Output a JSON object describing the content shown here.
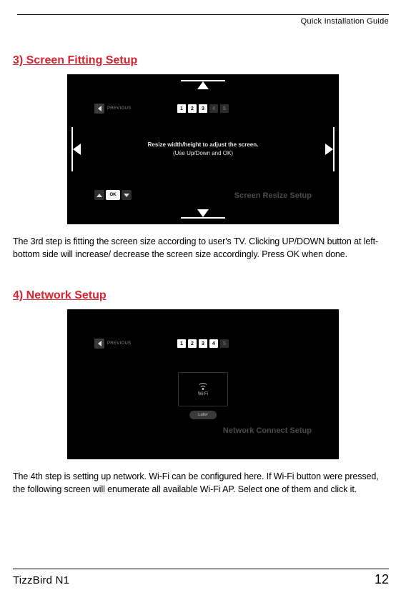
{
  "header": {
    "guide_label": "Quick Installation Guide"
  },
  "section3": {
    "title": "3) Screen Fitting Setup",
    "screen": {
      "previous": "PREVIOUS",
      "steps": [
        "1",
        "2",
        "3",
        "4",
        "5"
      ],
      "active_steps": [
        1,
        2,
        3
      ],
      "resize_line1": "Resize width/height to adjust the screen.",
      "resize_line2": "(Use Up/Down and OK)",
      "ok_label": "OK",
      "corner": "Screen Resize Setup"
    },
    "body": "The 3rd step is fitting the screen size according to user's TV. Clicking UP/DOWN button at left-bottom side will increase/ decrease the screen size accordingly. Press OK when done."
  },
  "section4": {
    "title": "4) Network Setup",
    "screen": {
      "previous": "PREVIOUS",
      "steps": [
        "1",
        "2",
        "3",
        "4",
        "5"
      ],
      "active_steps": [
        1,
        2,
        3,
        4
      ],
      "wifi_label": "Wi-Fi",
      "later_label": "Later",
      "corner": "Network Connect Setup"
    },
    "body": "The 4th step is setting up network. Wi-Fi can be configured here. If Wi-Fi button were pressed, the following screen will enumerate all available Wi-Fi AP. Select one of them and click it."
  },
  "footer": {
    "brand": "TizzBird N1",
    "page": "12"
  }
}
